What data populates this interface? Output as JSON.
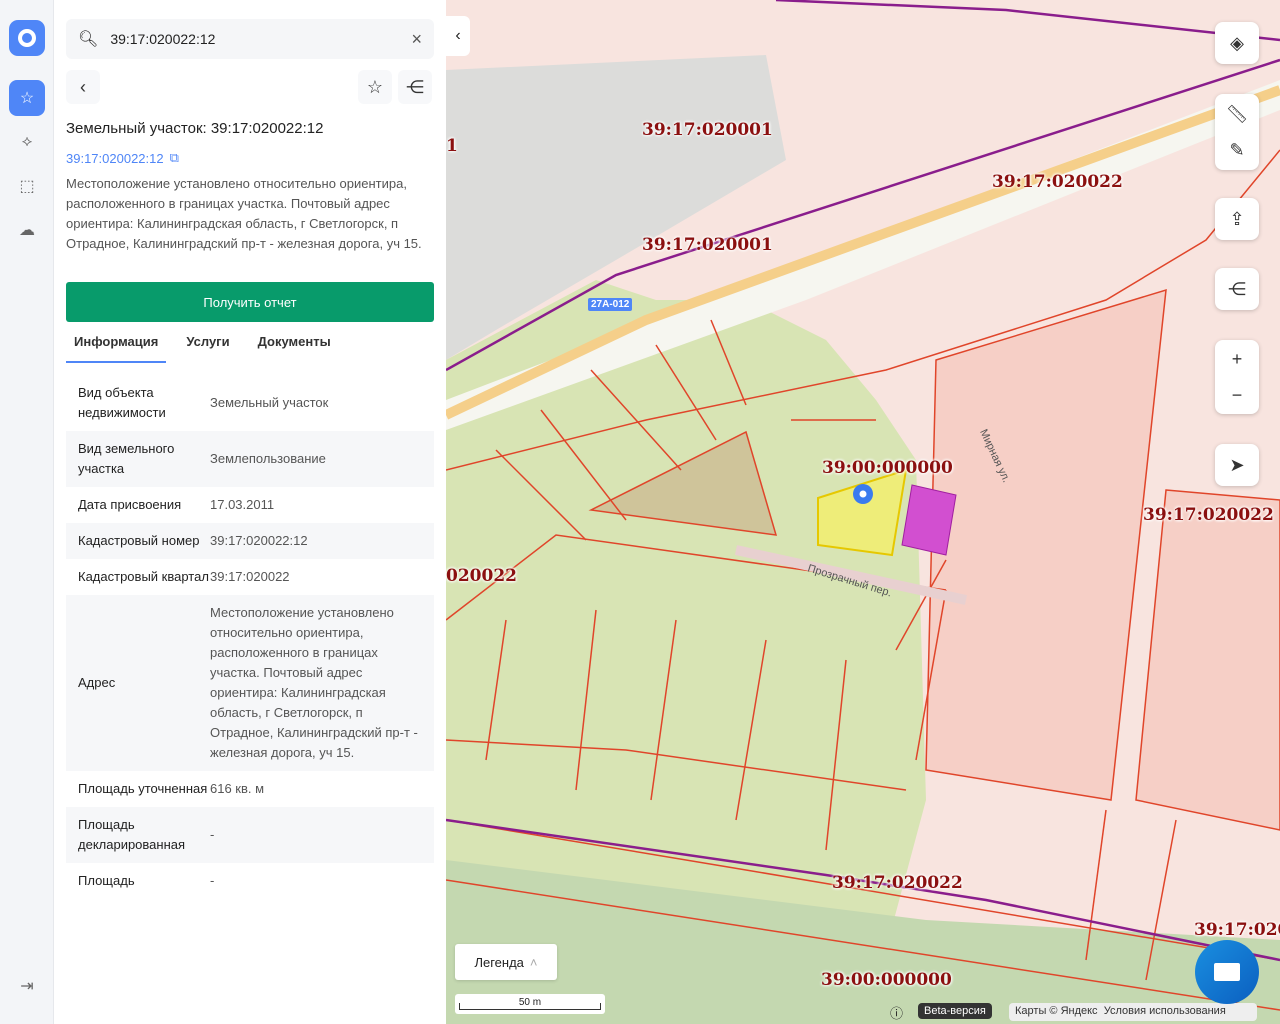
{
  "search": {
    "value": "39:17:020022:12"
  },
  "panel": {
    "title": "Земельный участок: 39:17:020022:12",
    "cadastral_link": "39:17:020022:12",
    "description": "Местоположение установлено относительно ориентира, расположенного в границах участка. Почтовый адрес ориентира: Калининградская область, г Светлогорск, п Отрадное, Калининградский пр-т - железная дорога, уч 15.",
    "report_button": "Получить отчет",
    "tabs": [
      {
        "label": "Информация"
      },
      {
        "label": "Услуги"
      },
      {
        "label": "Документы"
      }
    ],
    "rows": [
      {
        "k": "Вид объекта недвижимости",
        "v": "Земельный участок"
      },
      {
        "k": "Вид земельного участка",
        "v": "Землепользование"
      },
      {
        "k": "Дата присвоения",
        "v": "17.03.2011"
      },
      {
        "k": "Кадастровый номер",
        "v": "39:17:020022:12"
      },
      {
        "k": "Кадастровый квартал",
        "v": "39:17:020022"
      },
      {
        "k": "Адрес",
        "v": "Местоположение установлено относительно ориентира, расположенного в границах участка. Почтовый адрес ориентира: Калининградская область, г Светлогорск, п Отрадное, Калининградский пр-т - железная дорога, уч 15."
      },
      {
        "k": "Площадь уточненная",
        "v": "616 кв. м"
      },
      {
        "k": "Площадь декларированная",
        "v": "-"
      },
      {
        "k": "Площадь",
        "v": "-"
      }
    ]
  },
  "map": {
    "labels": [
      "39:17:020001",
      "39:17:020001",
      "39:17:020022",
      "39:00:000000",
      "39:17:020022",
      "020022",
      "39:17:020022",
      "39:00:000000",
      "39:17:020",
      "1"
    ],
    "road_badge": "27А-012",
    "streets": [
      "Мирная ул.",
      "Прозрачный пер."
    ],
    "legend": "Легенда",
    "scale": "50 m",
    "beta": "Beta-версия",
    "attribution": "Карты © Яндекс",
    "terms": "Условия использования",
    "colors": {
      "parcel_line": "#e0452a",
      "selected": "#f2ef6e",
      "building": "#d24fd0"
    }
  }
}
